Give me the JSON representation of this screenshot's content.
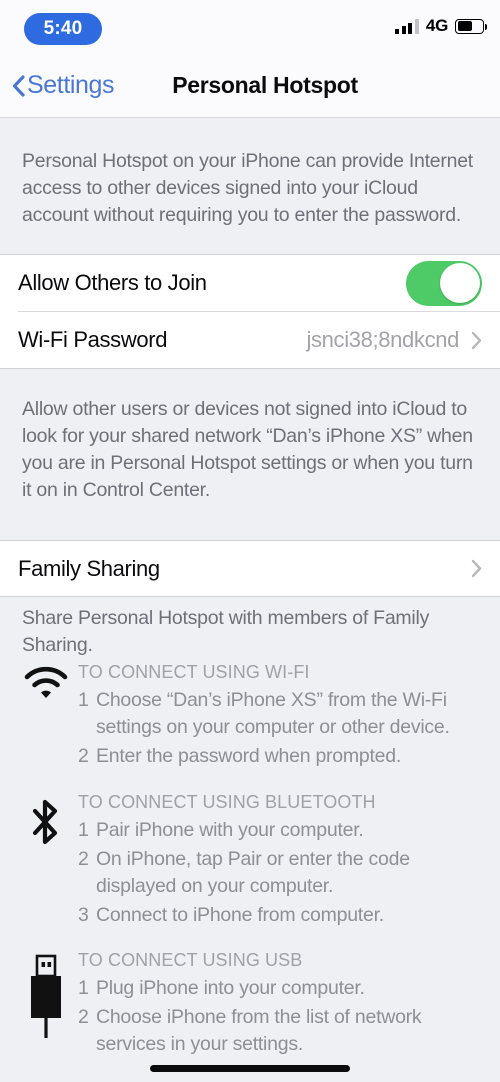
{
  "status_bar": {
    "time": "5:40",
    "network_label": "4G",
    "signal_bars_filled": 3,
    "signal_bars_total": 4,
    "battery_percent": 55,
    "time_pill_color": "#2f6be0"
  },
  "nav": {
    "back_label": "Settings",
    "title": "Personal Hotspot"
  },
  "intro_caption": "Personal Hotspot on your iPhone can provide Internet access to other devices signed into your iCloud account without requiring you to enter the password.",
  "hotspot_group": {
    "allow_others": {
      "label": "Allow Others to Join",
      "toggle_on": true,
      "toggle_color": "#4ecb66"
    },
    "wifi_password": {
      "label": "Wi-Fi Password",
      "value": "jsnci38;8ndkcnd"
    }
  },
  "allow_others_caption": "Allow other users or devices not signed into iCloud to look for your shared network “Dan’s iPhone XS” when you are in Personal Hotspot settings or when you turn it on in Control Center.",
  "family_sharing": {
    "label": "Family Sharing",
    "caption": "Share Personal Hotspot with members of Family Sharing."
  },
  "instructions": [
    {
      "icon": "wifi-icon",
      "heading": "TO CONNECT USING WI-FI",
      "steps": [
        {
          "num": "1",
          "text": "Choose “Dan’s iPhone XS” from the Wi-Fi settings on your computer or other device."
        },
        {
          "num": "2",
          "text": "Enter the password when prompted."
        }
      ]
    },
    {
      "icon": "bluetooth-icon",
      "heading": "TO CONNECT USING BLUETOOTH",
      "steps": [
        {
          "num": "1",
          "text": "Pair iPhone with your computer."
        },
        {
          "num": "2",
          "text": "On iPhone, tap Pair or enter the code displayed on your computer."
        },
        {
          "num": "3",
          "text": "Connect to iPhone from computer."
        }
      ]
    },
    {
      "icon": "usb-icon",
      "heading": "TO CONNECT USING USB",
      "steps": [
        {
          "num": "1",
          "text": "Plug iPhone into your computer."
        },
        {
          "num": "2",
          "text": "Choose iPhone from the list of network services in your settings."
        }
      ]
    }
  ]
}
